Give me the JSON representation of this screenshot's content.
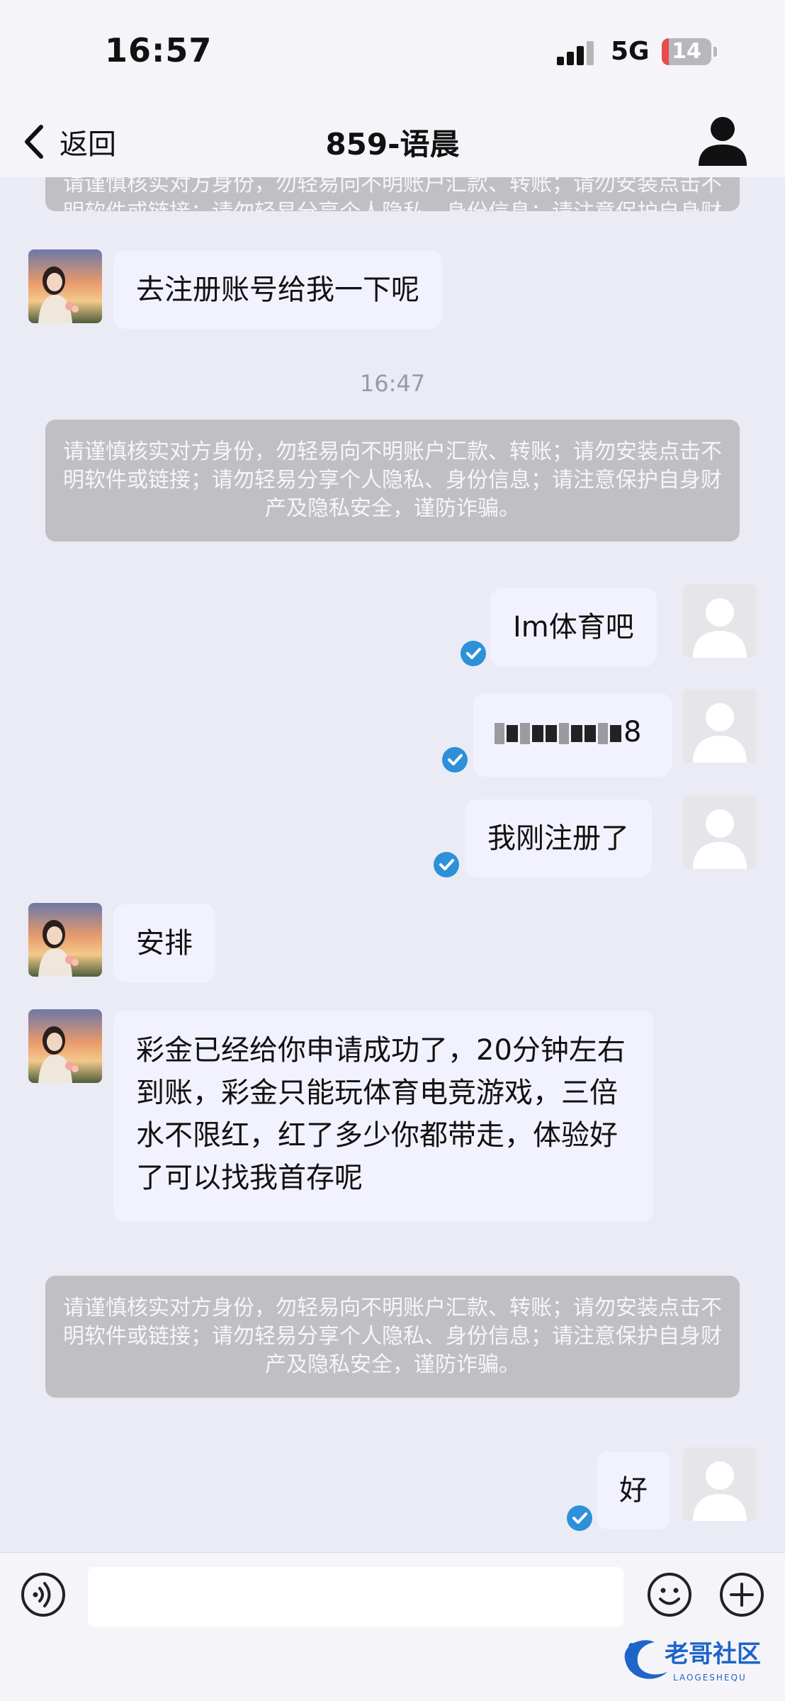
{
  "status_bar": {
    "time": "16:57",
    "network": "5G",
    "battery": "14"
  },
  "nav": {
    "back_label": "返回",
    "title": "859-语晨"
  },
  "notice_text": "请谨慎核实对方身份，勿轻易向不明账户汇款、转账；请勿安装点击不明软件或链接；请勿轻易分享个人隐私、身份信息；请注意保护自身财产及隐私安全，谨防诈骗。",
  "messages": [
    {
      "side": "left",
      "text": "去注册账号给我一下呢"
    },
    {
      "timestamp": "16:47"
    },
    {
      "side": "right",
      "text": "Im体育吧",
      "read": true
    },
    {
      "side": "right",
      "text": "8",
      "note": "obscured",
      "read": true
    },
    {
      "side": "right",
      "text": "我刚注册了",
      "read": true
    },
    {
      "side": "left",
      "text": "安排"
    },
    {
      "side": "left",
      "text": "彩金已经给你申请成功了，20分钟左右到账，彩金只能玩体育电竞游戏，三倍水不限红，红了多少你都带走，体验好了可以找我首存呢"
    },
    {
      "side": "right",
      "text": "好",
      "read": true
    }
  ],
  "input": {
    "placeholder": ""
  },
  "watermark": {
    "text": "老哥社区",
    "subtext": "LAOGESHEQU"
  },
  "colors": {
    "bubble": "#f1f2fd",
    "notice_bg": "#bfbfc4",
    "tick": "#2e90d8",
    "background": "#ebebf5"
  }
}
